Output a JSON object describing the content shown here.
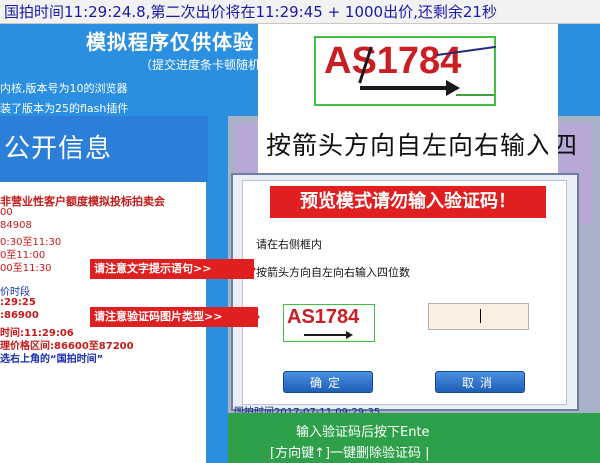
{
  "topbar": {
    "status": "国拍时间11:29:24.8,第二次出价将在11:29:45 + 1000出价,还剩余21秒"
  },
  "background": {
    "title": "模拟程序仅供体验",
    "subtitle": "（提交进度条卡顿随机",
    "version_a": "内核,版本号为10的浏览器",
    "version_b": "装了版本为25的flash插件"
  },
  "left_panel": {
    "header": "公开信息",
    "lines": [
      "非营业性客户额度模拟投标拍卖会",
      "00",
      "84908",
      "0:30至11:30",
      "0至11:00",
      "00至11:30",
      "价时段",
      ":29:25",
      ":86900",
      "时间:11:29:06",
      "理价格区间:86600至87200",
      "选右上角的“国拍时间”"
    ]
  },
  "captcha": {
    "code": "AS1784",
    "instruction": "按箭头方向自左向右输入四"
  },
  "dialog": {
    "banner": "预览模式请勿输入验证码！",
    "line1": "请在右侧框内",
    "line2": "按箭头方向自左向右输入四位数",
    "small_code": "AS1784",
    "input_value": "",
    "ok_label": "确定",
    "cancel_label": "取消"
  },
  "hints": {
    "text_hint": "请注意文字提示语句>>",
    "image_hint": "请注意验证码图片类型>>"
  },
  "bottom": {
    "obscured": "国拍时间2017-07-11 09:29:35",
    "line1": "输入验证码后按下Ente",
    "line2": "[方向键↑]一键删除验证码 |"
  },
  "colors": {
    "bg_blue": "#2a8fe0",
    "alert_red": "#e02020",
    "captcha_red": "#cc1e22",
    "bottom_green": "#2ea04a"
  }
}
